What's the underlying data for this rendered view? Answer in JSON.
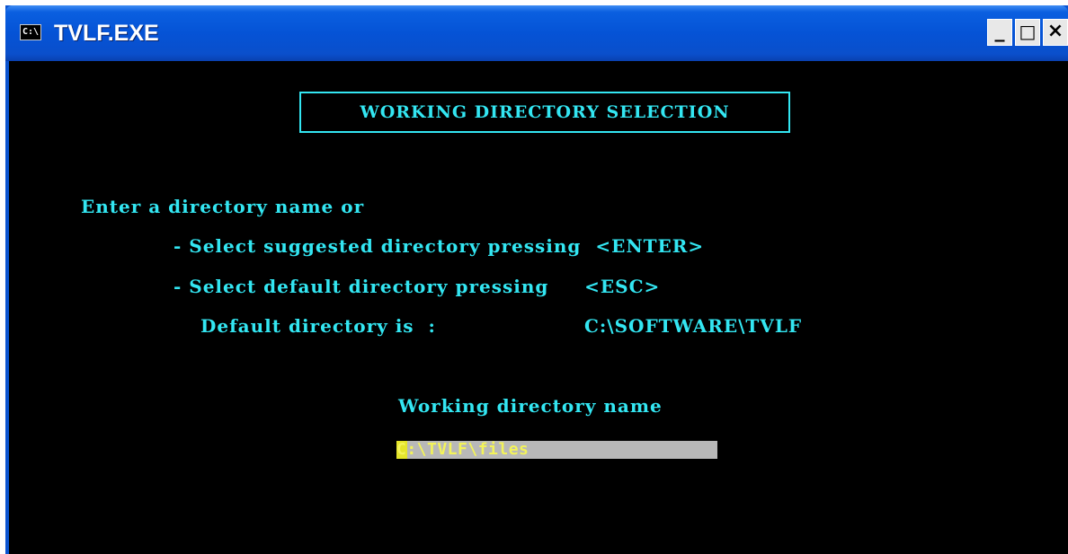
{
  "window": {
    "title": "TVLF.EXE",
    "system_icon_label": "C:\\",
    "controls": {
      "minimize": "_",
      "maximize": "□",
      "close": "×"
    }
  },
  "console": {
    "header_title": "WORKING DIRECTORY SELECTION",
    "prompt_line": "Enter a directory name or",
    "option_suggested": "- Select suggested directory pressing  <ENTER>",
    "option_default": "- Select default directory pressing     <ESC>",
    "default_dir_label": "Default directory is  :",
    "default_dir_value": "C:\\SOFTWARE\\TVLF",
    "working_dir_label": "Working directory name",
    "working_dir_input": "C:\\TVLF\\files"
  },
  "colors": {
    "console_background": "#000000",
    "console_text": "#33e6f2",
    "input_field_background": "#b8b8b8",
    "input_text": "#f3f35a",
    "titlebar": "#0553d6"
  }
}
